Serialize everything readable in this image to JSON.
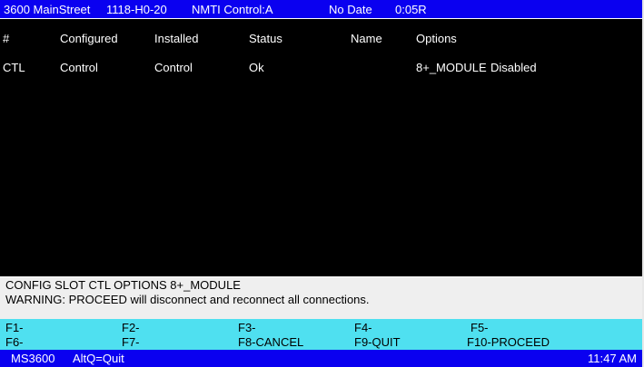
{
  "colors": {
    "title_bar": "#0a00f0",
    "background": "#000000",
    "message_area": "#efefef",
    "function_key_area": "#4fe0f0",
    "status_bar": "#0a00f0"
  },
  "title_bar": {
    "location": "3600 MainStreet",
    "node": "1118-H0-20",
    "control": "NMTI Control:A",
    "date": "No Date",
    "session": "0:05R"
  },
  "table": {
    "headers": [
      "#",
      "Configured",
      "Installed",
      "Status",
      "Name",
      "Options"
    ],
    "rows": [
      {
        "slot": "CTL",
        "configured": "Control",
        "installed": "Control",
        "status": "Ok",
        "name": "",
        "option_module": "8+_MODULE",
        "option_state": "Disabled"
      }
    ]
  },
  "message_area": {
    "command": "CONFIG SLOT CTL OPTIONS 8+_MODULE",
    "warning": "WARNING: PROCEED will disconnect and reconnect all connections."
  },
  "function_keys": {
    "f1": "F1-",
    "f2": "F2-",
    "f3": "F3-",
    "f4": "F4-",
    "f5": "F5-",
    "f6": "F6-",
    "f7": "F7-",
    "f8": "F8-CANCEL",
    "f9": "F9-QUIT",
    "f10": "F10-PROCEED"
  },
  "status_bar": {
    "system": "MS3600",
    "quit_hint": "AltQ=Quit",
    "time": "11:47 AM"
  }
}
